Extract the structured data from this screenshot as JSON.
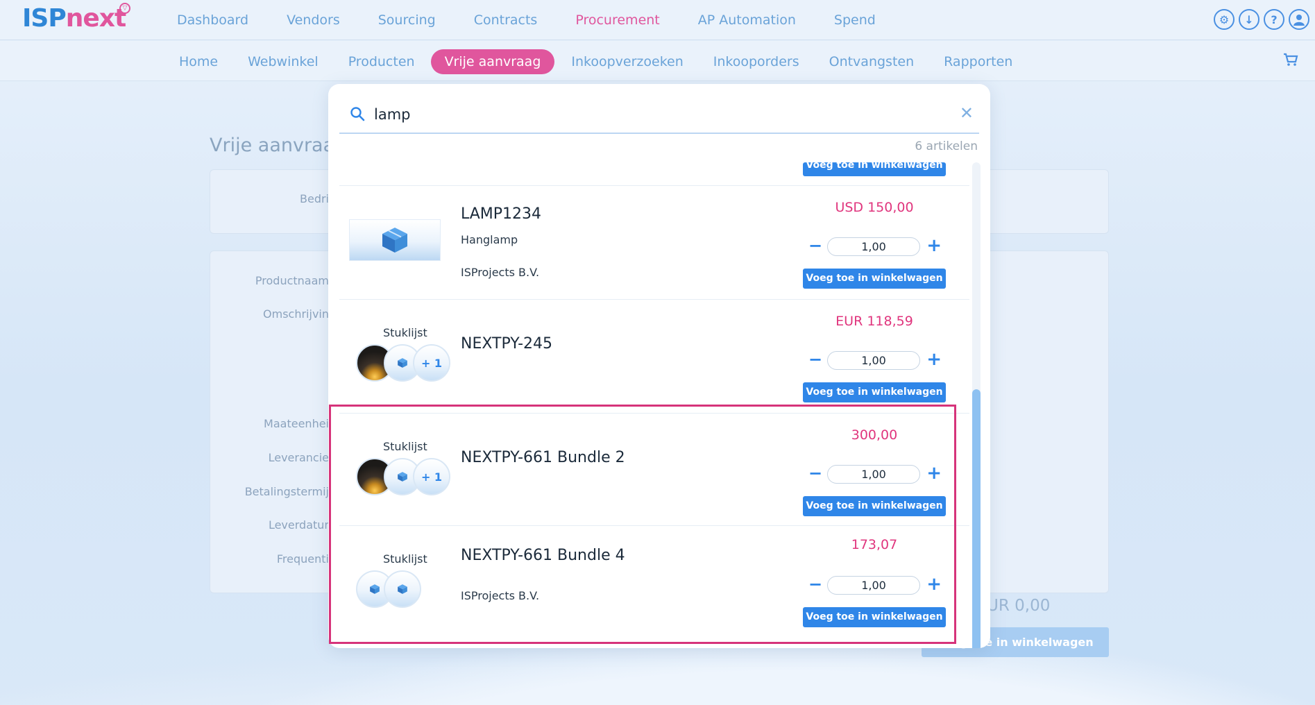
{
  "logo": {
    "part1": "ISP",
    "part2": "next"
  },
  "main_nav": [
    "Dashboard",
    "Vendors",
    "Sourcing",
    "Contracts",
    "Procurement",
    "AP Automation",
    "Spend"
  ],
  "sub_nav": [
    "Home",
    "Webwinkel",
    "Producten",
    "Vrije aanvraag",
    "Inkoopverzoeken",
    "Inkooporders",
    "Ontvangsten",
    "Rapporten"
  ],
  "page": {
    "title": "Vrije aanvraag",
    "labels": [
      "Bedri",
      "Productnaam",
      "Omschrijvin",
      "Maateenhei",
      "Leverancie",
      "Betalingstermij",
      "Leverdatur",
      "Frequenti"
    ],
    "total": "UR 0,00",
    "add_button": "Voeg toe in winkelwagen"
  },
  "search": {
    "query": "lamp",
    "count": "6 artikelen"
  },
  "products": [
    {
      "name": "LAMP1234",
      "description": "Hanglamp",
      "vendor": "ISProjects B.V.",
      "price": "USD 150,00",
      "qty": "1,00",
      "button": "Voeg toe in winkelwagen"
    },
    {
      "label": "Stuklijst",
      "name": "NEXTPY-245",
      "extra": "+ 1",
      "price": "EUR 118,59",
      "qty": "1,00",
      "button": "Voeg toe in winkelwagen"
    },
    {
      "label": "Stuklijst",
      "name": "NEXTPY-661 Bundle 2",
      "extra": "+ 1",
      "price": "300,00",
      "qty": "1,00",
      "button": "Voeg toe in winkelwagen"
    },
    {
      "label": "Stuklijst",
      "name": "NEXTPY-661 Bundle 4",
      "vendor": "ISProjects B.V.",
      "price": "173,07",
      "qty": "1,00",
      "button": "Voeg toe in winkelwagen"
    }
  ],
  "partial_top_button": "Voeg toe in winkelwagen",
  "colors": {
    "accent": "#2f86e8",
    "brand_pink": "#e0569d",
    "price": "#e0357d"
  }
}
